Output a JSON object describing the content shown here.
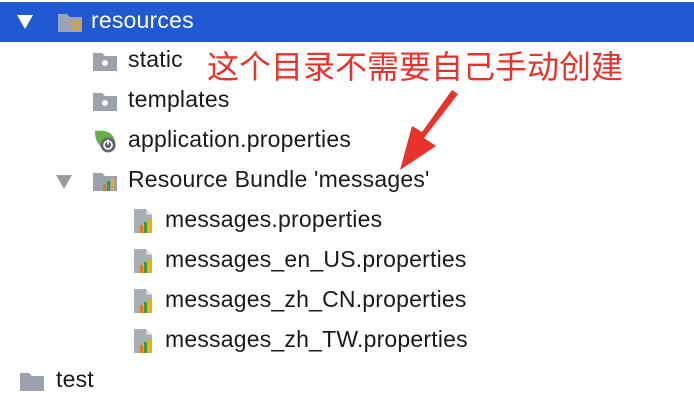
{
  "tree": {
    "items": [
      {
        "label": "resources",
        "icon": "resources-folder-icon",
        "expanded": true,
        "selected": true
      },
      {
        "label": "static",
        "icon": "folder-icon"
      },
      {
        "label": "templates",
        "icon": "folder-icon"
      },
      {
        "label": "application.properties",
        "icon": "spring-boot-icon"
      },
      {
        "label": "Resource Bundle 'messages'",
        "icon": "resource-bundle-icon",
        "expanded": true
      },
      {
        "label": "messages.properties",
        "icon": "properties-file-icon"
      },
      {
        "label": "messages_en_US.properties",
        "icon": "properties-file-icon"
      },
      {
        "label": "messages_zh_CN.properties",
        "icon": "properties-file-icon"
      },
      {
        "label": "messages_zh_TW.properties",
        "icon": "properties-file-icon"
      },
      {
        "label": "test",
        "icon": "folder-icon"
      }
    ]
  },
  "annotation": {
    "text": "这个目录不需要自己手动创建"
  },
  "colors": {
    "selection": "#2059d1",
    "annotation": "#e8332c",
    "text": "#1a1a1a"
  }
}
